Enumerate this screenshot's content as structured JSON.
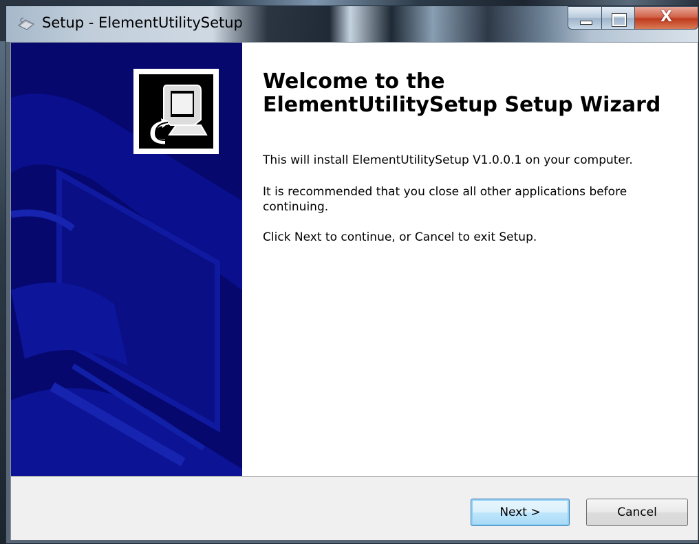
{
  "window": {
    "title": "Setup - ElementUtilitySetup",
    "icon": "setup-computer-icon"
  },
  "caption_buttons": {
    "minimize_icon": "minimize-icon",
    "maximize_icon": "maximize-icon",
    "close_label": "X"
  },
  "wizard": {
    "heading_line1": "Welcome to the",
    "heading_line2": "ElementUtilitySetup Setup Wizard",
    "paragraphs": [
      "This will install ElementUtilitySetup V1.0.0.1 on your computer.",
      "It is recommended that you close all other applications before continuing.",
      "Click Next to continue, or Cancel to exit Setup."
    ],
    "sidebar_color": "#06086e",
    "logo_icon": "installer-computer-icon"
  },
  "footer": {
    "next_label": "Next >",
    "cancel_label": "Cancel"
  }
}
